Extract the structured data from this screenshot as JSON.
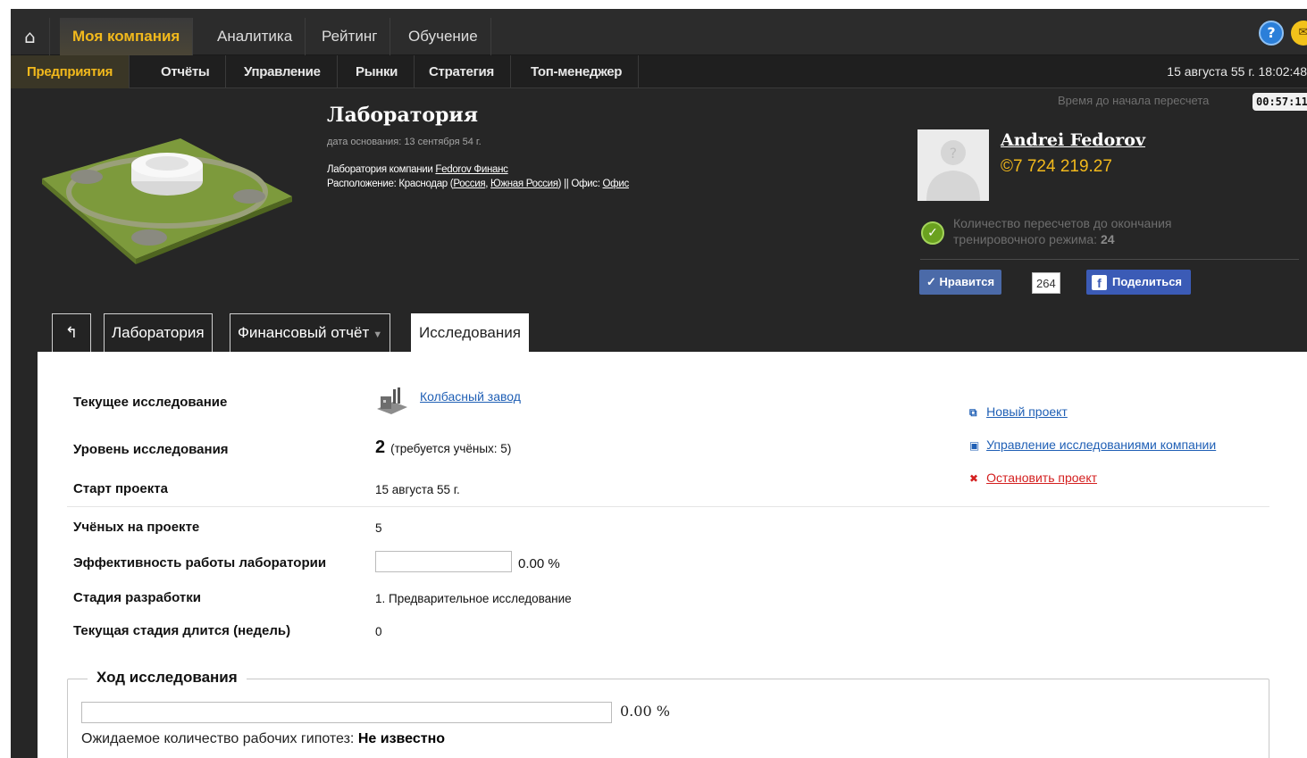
{
  "topnav": {
    "home_icon": "home-icon",
    "tabs": [
      {
        "label": "Моя компания",
        "active": true
      },
      {
        "label": "Аналитика",
        "active": false
      },
      {
        "label": "Рейтинг",
        "active": false
      },
      {
        "label": "Обучение",
        "active": false
      }
    ],
    "help_glyph": "?"
  },
  "subnav": {
    "tabs": [
      {
        "label": "Предприятия",
        "active": true
      },
      {
        "label": "Отчёты",
        "active": false
      },
      {
        "label": "Управление",
        "active": false
      },
      {
        "label": "Рынки",
        "active": false
      },
      {
        "label": "Стратегия",
        "active": false
      },
      {
        "label": "Топ-менеджер",
        "active": false
      }
    ],
    "datetime": "15 августа 55 г.  18:02:48"
  },
  "header": {
    "recalc_label": "Время до начала пересчета",
    "recalc_timer": "00:57:11",
    "unit_title": "Лаборатория",
    "founded": "дата основания: 13 сентября 54 г.",
    "info_prefix": "Лаборатория компании ",
    "company_link": "Fedorov Финанс",
    "location_prefix": "Расположение: Краснодар (",
    "country_link": "Россия",
    "comma": ", ",
    "region_link": "Южная Россия",
    "office_sep": ") || Офис: ",
    "office_link": "Офис"
  },
  "user": {
    "name": "Andrei Fedorov",
    "balance": "©7 724 219.27",
    "training_text": "Количество пересчетов до окончания тренировочного режима: ",
    "training_count": "24",
    "like_label": "✓ Нравится",
    "like_count": "264",
    "share_label": "Поделиться",
    "avatar_glyph": "?"
  },
  "unit_tabs": {
    "back_glyph": "↰",
    "lab": "Лаборатория",
    "finance": "Финансовый отчёт",
    "research": "Исследования"
  },
  "research": {
    "current_label": "Текущее исследование",
    "current_value": "Колбасный завод",
    "level_label": "Уровень исследования",
    "level_value": "2",
    "level_note": "(требуется учёных: 5)",
    "start_label": "Старт проекта",
    "start_value": "15 августа 55 г.",
    "scientists_label": "Учёных на проекте",
    "scientists_value": "5",
    "efficiency_label": "Эффективность работы лаборатории",
    "efficiency_value": "0.00 %",
    "efficiency_fraction": 0,
    "stage_label": "Стадия разработки",
    "stage_value": "1. Предварительное исследование",
    "stage_weeks_label": "Текущая стадия длится (недель)",
    "stage_weeks_value": "0"
  },
  "actions": {
    "new_project": "Новый проект",
    "manage": "Управление исследованиями компании",
    "stop": "Остановить проект"
  },
  "progress": {
    "legend": "Ход исследования",
    "value": "0.00 %",
    "fraction": 0,
    "hypo_label": "Ожидаемое количество рабочих гипотез: ",
    "hypo_value": "Не известно"
  },
  "colors": {
    "accent": "#f2b91c",
    "link": "#1f5fb5",
    "stop": "#d42020"
  }
}
